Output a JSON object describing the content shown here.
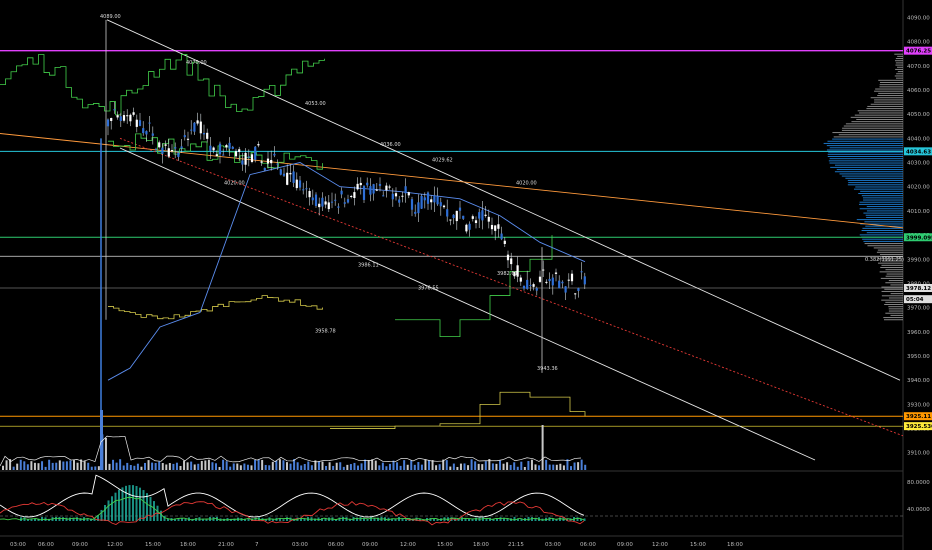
{
  "chart_data": {
    "type": "candlestick",
    "y_axis": {
      "range": [
        3900,
        4100
      ],
      "ticks": [
        "4090.00",
        "4080.00",
        "4070.00",
        "4060.00",
        "4050.00",
        "4040.00",
        "4030.00",
        "4020.00",
        "4010.00",
        "4000.00",
        "3990.00",
        "3980.00",
        "3970.00",
        "3960.00",
        "3950.00",
        "3940.00",
        "3930.00",
        "3920.00",
        "3910.00"
      ]
    },
    "x_axis": {
      "ticks": [
        "03:00",
        "06:00",
        "09:00",
        "12:00",
        "15:00",
        "18:00",
        "21:00",
        "7",
        "03:00",
        "06:00",
        "09:00",
        "12:00",
        "15:00",
        "18:00",
        "21:15",
        "03:00",
        "06:00",
        "09:00",
        "12:00",
        "15:00",
        "18:00"
      ]
    },
    "price_tags": [
      {
        "text": "4076.25",
        "color": "#e040fb",
        "value": 4076.25
      },
      {
        "text": "4034.63",
        "color": "#26c6da",
        "value": 4034.63
      },
      {
        "text": "3999.0957",
        "color": "#2ecc71",
        "value": 3999.1
      },
      {
        "text": "3978.12",
        "color": "#e0e0e0",
        "value": 3978.12
      },
      {
        "text": "05:04",
        "color": "#e0e0e0",
        "value": 3973.5
      },
      {
        "text": "3925.11",
        "color": "#ff9800",
        "value": 3925.11
      },
      {
        "text": "3925.5367",
        "color": "#ffeb3b",
        "value": 3921.0
      }
    ],
    "fib_label": "0.382(3991.25)",
    "annotations": [
      {
        "text": "4089.00",
        "value": 4089
      },
      {
        "text": "4070.00",
        "value": 4070
      },
      {
        "text": "4053.00",
        "value": 4053
      },
      {
        "text": "4036.00",
        "value": 4036
      },
      {
        "text": "4029.62",
        "value": 4029.6
      },
      {
        "text": "4020.00",
        "value": 4020
      },
      {
        "text": "4020.00",
        "value": 4020
      },
      {
        "text": "3986.11",
        "value": 3986.1
      },
      {
        "text": "3982.61",
        "value": 3982.6
      },
      {
        "text": "3976.55",
        "value": 3976.6
      },
      {
        "text": "3958.78",
        "value": 3958.8
      },
      {
        "text": "3943.36",
        "value": 3943.4
      }
    ],
    "oscillator_axis": {
      "ticks": [
        "80.0000",
        "40.0000"
      ]
    }
  }
}
